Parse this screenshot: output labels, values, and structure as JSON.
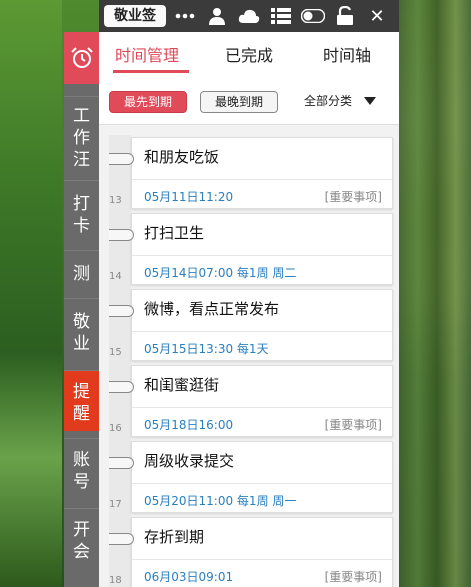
{
  "toolbar": {
    "brand": "敬业签",
    "icons": [
      "more-icon",
      "user-icon",
      "cloud-icon",
      "list-icon",
      "toggle-icon",
      "unlock-icon",
      "close-icon"
    ],
    "close_glyph": "✕"
  },
  "sidebar": {
    "items": [
      {
        "label": "工作汪"
      },
      {
        "label": "打卡"
      },
      {
        "label": "测"
      },
      {
        "label": "敬业"
      },
      {
        "label": "提醒"
      },
      {
        "label": "账号"
      },
      {
        "label": "开会"
      }
    ],
    "active": "提醒"
  },
  "tabs": [
    {
      "label": "时间管理",
      "active": true
    },
    {
      "label": "已完成",
      "active": false
    },
    {
      "label": "时间轴",
      "active": false
    }
  ],
  "filters": {
    "earliest_label": "最先到期",
    "latest_label": "最晚到期",
    "category_label": "全部分类"
  },
  "items": [
    {
      "num": "13",
      "title": "和朋友吃饭",
      "time": "05月11日11:20",
      "tag": "[重要事项]"
    },
    {
      "num": "14",
      "title": "打扫卫生",
      "time": "05月14日07:00 每1周 周二",
      "tag": ""
    },
    {
      "num": "15",
      "title": "微博，看点正常发布",
      "time": "05月15日13:30 每1天",
      "tag": ""
    },
    {
      "num": "16",
      "title": "和闺蜜逛街",
      "time": "05月18日16:00",
      "tag": "[重要事项]"
    },
    {
      "num": "17",
      "title": "周级收录提交",
      "time": "05月20日11:00 每1周 周一",
      "tag": ""
    },
    {
      "num": "18",
      "title": "存折到期",
      "time": "06月03日09:01",
      "tag": "[重要事项]"
    }
  ],
  "colors": {
    "accent": "#e04a59",
    "nav_active": "#e23a1c",
    "link": "#2a7fbf"
  }
}
